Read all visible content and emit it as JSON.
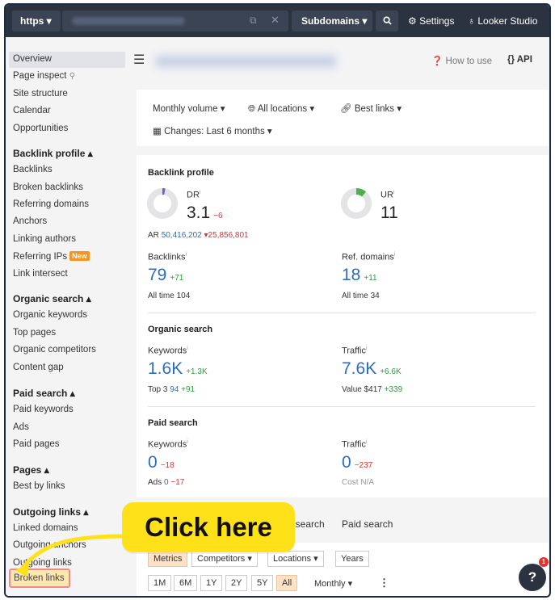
{
  "topbar": {
    "protocol": "https ▾",
    "mode": "Subdomains ▾",
    "settings": "Settings",
    "looker": "Looker Studio"
  },
  "sidebar": {
    "items_top": [
      "Overview",
      "Page inspect",
      "Site structure",
      "Calendar",
      "Opportunities"
    ],
    "backlink_head": "Backlink profile ▴",
    "backlink_items": [
      "Backlinks",
      "Broken backlinks",
      "Referring domains",
      "Anchors",
      "Linking authors",
      "Referring IPs",
      "Link intersect"
    ],
    "new_badge": "New",
    "organic_head": "Organic search ▴",
    "organic_items": [
      "Organic keywords",
      "Top pages",
      "Organic competitors",
      "Content gap"
    ],
    "paid_head": "Paid search ▴",
    "paid_items": [
      "Paid keywords",
      "Ads",
      "Paid pages"
    ],
    "pages_head": "Pages ▴",
    "pages_items": [
      "Best by links"
    ],
    "outgoing_head": "Outgoing links ▴",
    "outgoing_items": [
      "Linked domains",
      "Outgoing anchors",
      "Outgoing links",
      "Broken links"
    ]
  },
  "header": {
    "how_to_use": "How to use",
    "api": "{} API"
  },
  "filters": {
    "volume": "Monthly volume ▾",
    "locations": "All locations ▾",
    "best_links": "Best links ▾",
    "changes": "Changes: Last 6 months ▾"
  },
  "overview": {
    "backlink_title": "Backlink profile",
    "dr_label": "DR",
    "dr_value": "3.1",
    "dr_delta": "−6",
    "dr_ring_fraction": 0.031,
    "ur_label": "UR",
    "ur_value": "11",
    "ur_ring_fraction": 0.11,
    "ar_label": "AR",
    "ar_value": "50,416,202",
    "ar_delta": "▾25,856,801",
    "backlinks_label": "Backlinks",
    "backlinks_value": "79",
    "backlinks_delta": "+71",
    "backlinks_alltime_label": "All time",
    "backlinks_alltime": "104",
    "refdomains_label": "Ref. domains",
    "refdomains_value": "18",
    "refdomains_delta": "+11",
    "refdomains_alltime_label": "All time",
    "refdomains_alltime": "34",
    "organic_title": "Organic search",
    "keywords_label": "Keywords",
    "keywords_value": "1.6K",
    "keywords_delta": "+1.3K",
    "top3_label": "Top 3",
    "top3_value": "94",
    "top3_delta": "+91",
    "traffic_label": "Traffic",
    "traffic_value": "7.6K",
    "traffic_delta": "+6.6K",
    "value_label": "Value",
    "value_value": "$417",
    "value_delta": "+339",
    "paid_title": "Paid search",
    "paid_keywords_label": "Keywords",
    "paid_keywords_value": "0",
    "paid_keywords_delta": "−18",
    "ads_label": "Ads",
    "ads_value": "0",
    "ads_delta": "−17",
    "paid_traffic_label": "Traffic",
    "paid_traffic_value": "0",
    "paid_traffic_delta": "−237",
    "cost_label": "Cost",
    "cost_value": "N/A"
  },
  "tabs": [
    "nic search",
    "Paid search"
  ],
  "chart_controls": {
    "metrics": "Metrics",
    "competitors": "Competitors ▾",
    "locations": "Locations ▾",
    "years": "Years",
    "ranges": [
      "1M",
      "6M",
      "1Y",
      "2Y",
      "5Y",
      "All"
    ],
    "interval": "Monthly ▾",
    "more": "⋮"
  },
  "callout": "Click here",
  "help": {
    "label": "?",
    "badge": "1"
  },
  "colors": {
    "topbar": "#2b3340",
    "accent_blue": "#2b6cc4",
    "positive": "#2a9d3c",
    "negative": "#e03131",
    "callout": "#ffe11a",
    "dr_ring": "#6f5bd6",
    "ur_ring": "#4caf50"
  }
}
